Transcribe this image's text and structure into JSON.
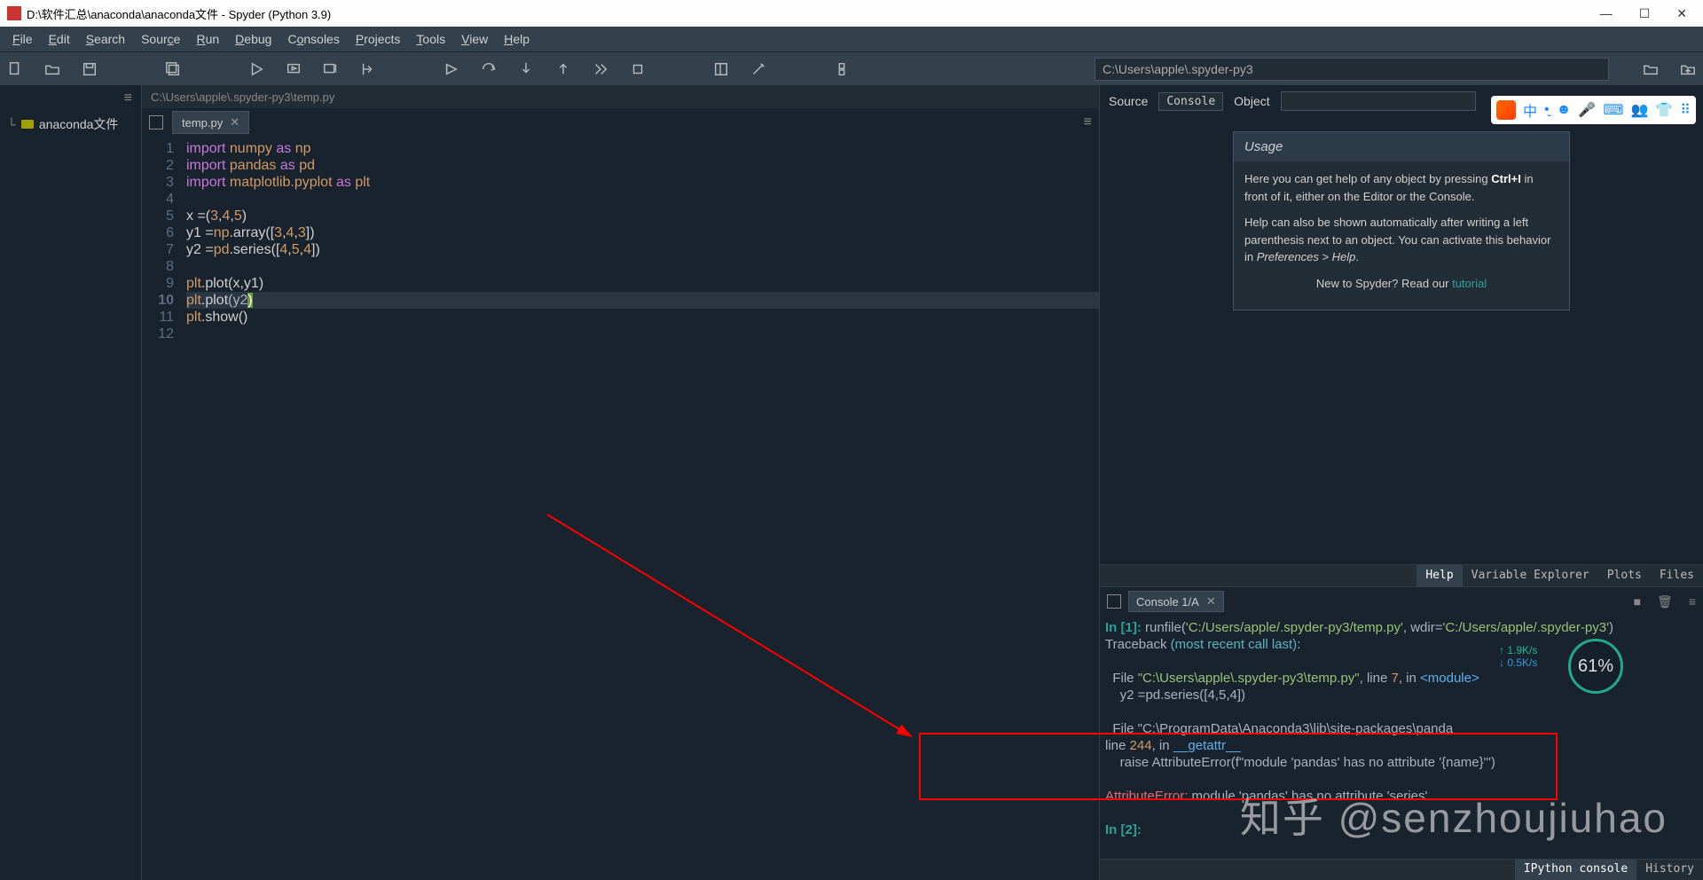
{
  "title": "D:\\软件汇总\\anaconda\\anaconda文件 - Spyder (Python 3.9)",
  "window_controls": {
    "min": "—",
    "max": "☐",
    "close": "✕"
  },
  "menu": [
    "File",
    "Edit",
    "Search",
    "Source",
    "Run",
    "Debug",
    "Consoles",
    "Projects",
    "Tools",
    "View",
    "Help"
  ],
  "toolbar_path": "C:\\Users\\apple\\.spyder-py3",
  "sidebar": {
    "item": "anaconda文件"
  },
  "editor": {
    "file_path": "C:\\Users\\apple\\.spyder-py3\\temp.py",
    "tab": "temp.py",
    "code_lines": [
      "import numpy as np",
      "import pandas as pd",
      "import matplotlib.pyplot as plt",
      "",
      "x =(3,4,5)",
      "y1 =np.array([3,4,3])",
      "y2 =pd.series([4,5,4])",
      "",
      "plt.plot(x,y1)",
      "plt.plot(y2)",
      "plt.show()",
      ""
    ],
    "current_line": 10
  },
  "help": {
    "source_label": "Source",
    "console_label": "Console",
    "object_label": "Object",
    "usage_title": "Usage",
    "p1_pre": "Here you can get help of any object by pressing ",
    "p1_key": "Ctrl+I",
    "p1_post": " in front of it, either on the Editor or the Console.",
    "p2_pre": "Help can also be shown automatically after writing a left parenthesis next to an object. You can activate this behavior in ",
    "p2_pref": "Preferences > Help",
    "p2_post": ".",
    "p3_pre": "New to Spyder? Read our ",
    "p3_link": "tutorial",
    "tabs": [
      "Help",
      "Variable Explorer",
      "Plots",
      "Files"
    ],
    "active_tab": "Help"
  },
  "console": {
    "tab": "Console 1/A",
    "lines": [
      {
        "t": "mix",
        "parts": [
          {
            "c": "prompt",
            "v": "In [1]: "
          },
          {
            "c": "white",
            "v": "runfile("
          },
          {
            "c": "path-green",
            "v": "'C:/Users/apple/.spyder-py3/temp.py'"
          },
          {
            "c": "white",
            "v": ", wdir="
          },
          {
            "c": "path-green",
            "v": "'C:/Users/apple/.spyder-py3'"
          },
          {
            "c": "white",
            "v": ")"
          }
        ]
      },
      {
        "t": "mix",
        "parts": [
          {
            "c": "white",
            "v": "Traceback "
          },
          {
            "c": "tb-head",
            "v": "(most recent call last)"
          },
          {
            "c": "white",
            "v": ":"
          }
        ]
      },
      {
        "t": "blank"
      },
      {
        "t": "mix",
        "parts": [
          {
            "c": "white",
            "v": "  File "
          },
          {
            "c": "path-green",
            "v": "\"C:\\Users\\apple\\.spyder-py3\\temp.py\""
          },
          {
            "c": "white",
            "v": ", line "
          },
          {
            "c": "num-orange",
            "v": "7"
          },
          {
            "c": "white",
            "v": ", in "
          },
          {
            "c": "blue",
            "v": "<module>"
          }
        ]
      },
      {
        "t": "mix",
        "parts": [
          {
            "c": "white",
            "v": "    y2 =pd.series([4,5,4])"
          }
        ]
      },
      {
        "t": "blank"
      },
      {
        "t": "mix",
        "parts": [
          {
            "c": "white",
            "v": "  File \"C:\\ProgramData\\Anaconda3\\lib\\site-packages\\panda"
          }
        ]
      },
      {
        "t": "mix",
        "parts": [
          {
            "c": "white",
            "v": "line "
          },
          {
            "c": "num-orange",
            "v": "244"
          },
          {
            "c": "white",
            "v": ", in "
          },
          {
            "c": "blue",
            "v": "__getattr__"
          }
        ]
      },
      {
        "t": "mix",
        "parts": [
          {
            "c": "white",
            "v": "    raise AttributeError(f\"module 'pandas' has no attribute '{name}'\")"
          }
        ]
      },
      {
        "t": "blank"
      },
      {
        "t": "mix",
        "parts": [
          {
            "c": "err-red",
            "v": "AttributeError:"
          },
          {
            "c": "white",
            "v": " module 'pandas' has no attribute 'series'"
          }
        ]
      },
      {
        "t": "blank"
      },
      {
        "t": "mix",
        "parts": [
          {
            "c": "prompt",
            "v": "In [2]: "
          }
        ]
      }
    ],
    "bottom_tabs": [
      "IPython console",
      "History"
    ],
    "active_bottom": "IPython console"
  },
  "net": {
    "up": "↑ 1.9K/s",
    "down": "↓ 0.5K/s",
    "pct": "61%"
  },
  "watermark": "知乎 @senzhoujiuhao",
  "ime_icons": [
    "中",
    "•̮",
    "☻",
    "🎤",
    "⌨",
    "👥",
    "👕",
    "⠿"
  ]
}
